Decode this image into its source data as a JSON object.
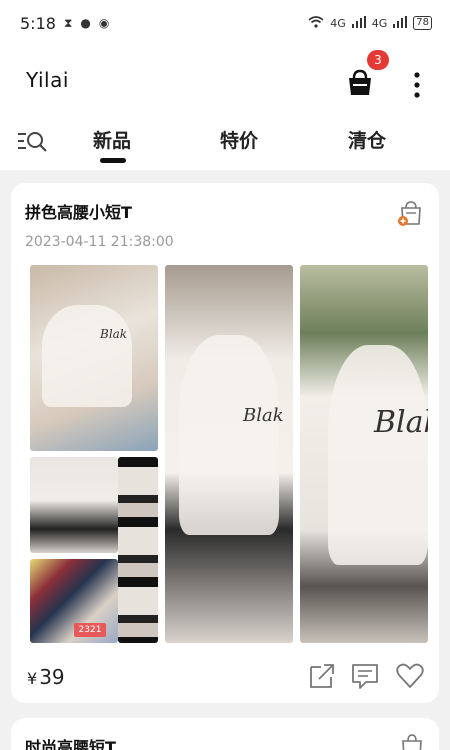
{
  "status": {
    "time": "5:18",
    "battery": "78",
    "network_1": "4G",
    "network_2": "4G"
  },
  "app": {
    "title": "Yilai",
    "cart_count": "3"
  },
  "tabs": [
    {
      "label": "新品",
      "selected": true
    },
    {
      "label": "特价",
      "selected": false
    },
    {
      "label": "清仓",
      "selected": false
    }
  ],
  "products": [
    {
      "title": "拼色高腰小短T",
      "date": "2023-04-11 21:38:00",
      "price_symbol": "¥",
      "price": "39",
      "image_brand_text": "Blak",
      "image_count_badge": "2321"
    },
    {
      "title": "时尚高腰短T"
    }
  ],
  "colors": {
    "accent": "#e53935",
    "badge": "#e85a5a",
    "text": "#111111",
    "muted": "#9a9a9a"
  },
  "icons": [
    "search-icon",
    "cart-icon",
    "more-icon",
    "bag-add-icon",
    "share-icon",
    "comment-icon",
    "heart-icon"
  ]
}
